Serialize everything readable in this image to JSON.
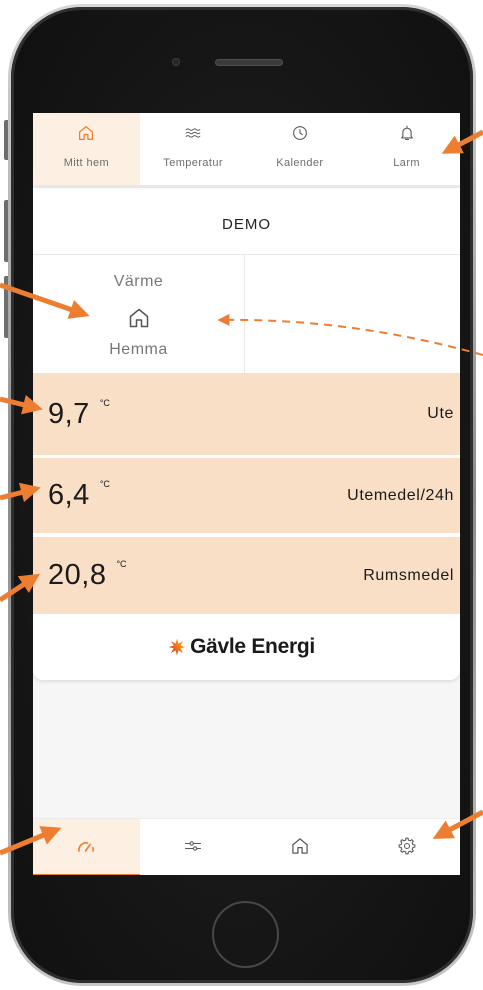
{
  "colors": {
    "accent": "#ed7d31",
    "peach": "#fadfc7",
    "selected_bg": "#fdf0e2",
    "icon": "#5a5a5a"
  },
  "top_tabs": [
    {
      "label": "Mitt hem",
      "icon": "home-icon",
      "selected": true
    },
    {
      "label": "Temperatur",
      "icon": "waves-icon",
      "selected": false
    },
    {
      "label": "Kalender",
      "icon": "clock-icon",
      "selected": false
    },
    {
      "label": "Larm",
      "icon": "bell-icon",
      "selected": false
    }
  ],
  "card": {
    "title": "DEMO",
    "tile": {
      "heading": "Värme",
      "icon": "home-icon",
      "value": "Hemma"
    },
    "readings": [
      {
        "value": "9,7",
        "unit": "°C",
        "label": "Ute"
      },
      {
        "value": "6,4",
        "unit": "°C",
        "label": "Utemedel/24h"
      },
      {
        "value": "20,8",
        "unit": "°C",
        "label": "Rumsmedel"
      }
    ],
    "brand": {
      "logo_icon": "sunburst-logo-icon",
      "name": "Gävle Energi"
    }
  },
  "bottom_nav": [
    {
      "icon": "speedometer-icon",
      "selected": true
    },
    {
      "icon": "sliders-icon",
      "selected": false
    },
    {
      "icon": "home-icon",
      "selected": false
    },
    {
      "icon": "gear-icon",
      "selected": false
    }
  ],
  "annotations": {
    "arrow_color": "#ed7d31",
    "style": "orange callout arrows"
  }
}
